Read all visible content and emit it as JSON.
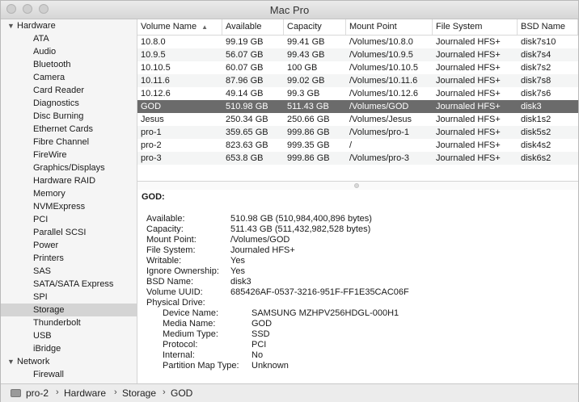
{
  "window": {
    "title": "Mac Pro"
  },
  "sidebar": {
    "groups": [
      {
        "label": "Hardware",
        "items": [
          "ATA",
          "Audio",
          "Bluetooth",
          "Camera",
          "Card Reader",
          "Diagnostics",
          "Disc Burning",
          "Ethernet Cards",
          "Fibre Channel",
          "FireWire",
          "Graphics/Displays",
          "Hardware RAID",
          "Memory",
          "NVMExpress",
          "PCI",
          "Parallel SCSI",
          "Power",
          "Printers",
          "SAS",
          "SATA/SATA Express",
          "SPI",
          "Storage",
          "Thunderbolt",
          "USB",
          "iBridge"
        ]
      },
      {
        "label": "Network",
        "items": [
          "Firewall"
        ]
      }
    ],
    "selected": "Storage"
  },
  "table": {
    "columns": [
      "Volume Name",
      "Available",
      "Capacity",
      "Mount Point",
      "File System",
      "BSD Name"
    ],
    "sort_column": "Volume Name",
    "rows": [
      [
        "10.8.0",
        "99.19 GB",
        "99.41 GB",
        "/Volumes/10.8.0",
        "Journaled HFS+",
        "disk7s10"
      ],
      [
        "10.9.5",
        "56.07 GB",
        "99.43 GB",
        "/Volumes/10.9.5",
        "Journaled HFS+",
        "disk7s4"
      ],
      [
        "10.10.5",
        "60.07 GB",
        "100 GB",
        "/Volumes/10.10.5",
        "Journaled HFS+",
        "disk7s2"
      ],
      [
        "10.11.6",
        "87.96 GB",
        "99.02 GB",
        "/Volumes/10.11.6",
        "Journaled HFS+",
        "disk7s8"
      ],
      [
        "10.12.6",
        "49.14 GB",
        "99.3 GB",
        "/Volumes/10.12.6",
        "Journaled HFS+",
        "disk7s6"
      ],
      [
        "GOD",
        "510.98 GB",
        "511.43 GB",
        "/Volumes/GOD",
        "Journaled HFS+",
        "disk3"
      ],
      [
        "Jesus",
        "250.34 GB",
        "250.66 GB",
        "/Volumes/Jesus",
        "Journaled HFS+",
        "disk1s2"
      ],
      [
        "pro-1",
        "359.65 GB",
        "999.86 GB",
        "/Volumes/pro-1",
        "Journaled HFS+",
        "disk5s2"
      ],
      [
        "pro-2",
        "823.63 GB",
        "999.35 GB",
        "/",
        "Journaled HFS+",
        "disk4s2"
      ],
      [
        "pro-3",
        "653.8 GB",
        "999.86 GB",
        "/Volumes/pro-3",
        "Journaled HFS+",
        "disk6s2"
      ]
    ],
    "selected_row": "GOD"
  },
  "detail": {
    "title": "GOD:",
    "fields": [
      [
        "Available:",
        "510.98 GB (510,984,400,896 bytes)"
      ],
      [
        "Capacity:",
        "511.43 GB (511,432,982,528 bytes)"
      ],
      [
        "Mount Point:",
        "/Volumes/GOD"
      ],
      [
        "File System:",
        "Journaled HFS+"
      ],
      [
        "Writable:",
        "Yes"
      ],
      [
        "Ignore Ownership:",
        "Yes"
      ],
      [
        "BSD Name:",
        "disk3"
      ],
      [
        "Volume UUID:",
        "685426AF-0537-3216-951F-FF1E35CAC06F"
      ]
    ],
    "physical_label": "Physical Drive:",
    "physical_fields": [
      [
        "Device Name:",
        "SAMSUNG MZHPV256HDGL-000H1"
      ],
      [
        "Media Name:",
        "GOD"
      ],
      [
        "Medium Type:",
        "SSD"
      ],
      [
        "Protocol:",
        "PCI"
      ],
      [
        "Internal:",
        "No"
      ],
      [
        "Partition Map Type:",
        "Unknown"
      ]
    ]
  },
  "pathbar": {
    "items": [
      "pro-2",
      "Hardware",
      "Storage",
      "GOD"
    ],
    "separator": "›"
  }
}
